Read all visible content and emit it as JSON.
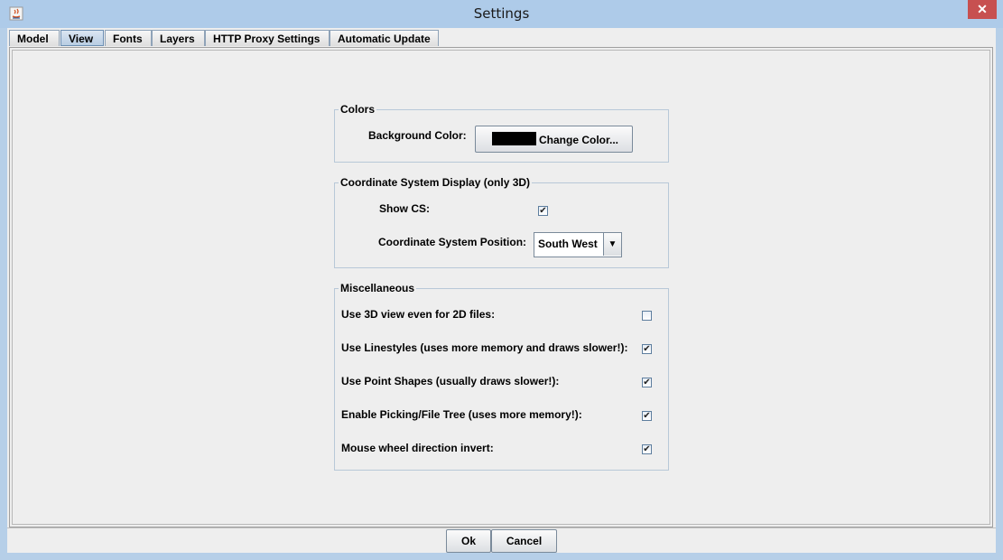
{
  "window": {
    "title": "Settings",
    "close_glyph": "✕",
    "icon": "java-app-icon"
  },
  "tabs": [
    {
      "label": "Model",
      "active": false
    },
    {
      "label": "View",
      "active": true
    },
    {
      "label": "Fonts",
      "active": false
    },
    {
      "label": "Layers",
      "active": false
    },
    {
      "label": "HTTP Proxy Settings",
      "active": false
    },
    {
      "label": "Automatic Update",
      "active": false
    }
  ],
  "colors": {
    "legend": "Colors",
    "background_label": "Background Color:",
    "swatch_color": "#000000",
    "change_button": "Change Color..."
  },
  "coordinate_system": {
    "legend": "Coordinate System Display (only 3D)",
    "show_cs_label": "Show CS:",
    "show_cs_checked": true,
    "position_label": "Coordinate System Position:",
    "position_value": "South West"
  },
  "misc": {
    "legend": "Miscellaneous",
    "items": [
      {
        "label": "Use 3D view even for 2D files:",
        "checked": false
      },
      {
        "label": "Use Linestyles (uses more memory and draws slower!):",
        "checked": true
      },
      {
        "label": "Use Point Shapes (usually draws slower!):",
        "checked": true
      },
      {
        "label": "Enable Picking/File Tree (uses more memory!):",
        "checked": true
      },
      {
        "label": "Mouse wheel direction invert:",
        "checked": true
      }
    ]
  },
  "footer": {
    "ok": "Ok",
    "cancel": "Cancel"
  },
  "check_glyph": "✔"
}
